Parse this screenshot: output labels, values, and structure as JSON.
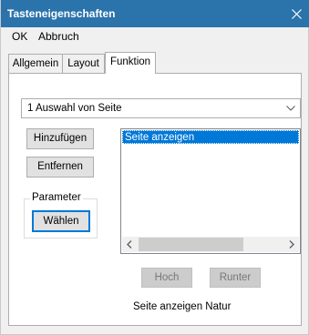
{
  "window": {
    "title": "Tasteneigenschaften",
    "accent_color": "#2b73ab",
    "close_icon": "close-icon"
  },
  "menu": {
    "ok": "OK",
    "abort": "Abbruch"
  },
  "tabs": [
    {
      "label": "Allgemein",
      "active": false
    },
    {
      "label": "Layout",
      "active": false
    },
    {
      "label": "Funktion",
      "active": true
    }
  ],
  "function_panel": {
    "combo_value": "1 Auswahl von Seite",
    "add_button": "Hinzufügen",
    "remove_button": "Entfernen",
    "list_items": [
      "Seite anzeigen"
    ],
    "selected_item": "Seite anzeigen",
    "parameter_group": "Parameter",
    "choose_button": "Wählen",
    "up_button": "Hoch",
    "down_button": "Runter",
    "description": "Seite anzeigen Natur"
  }
}
